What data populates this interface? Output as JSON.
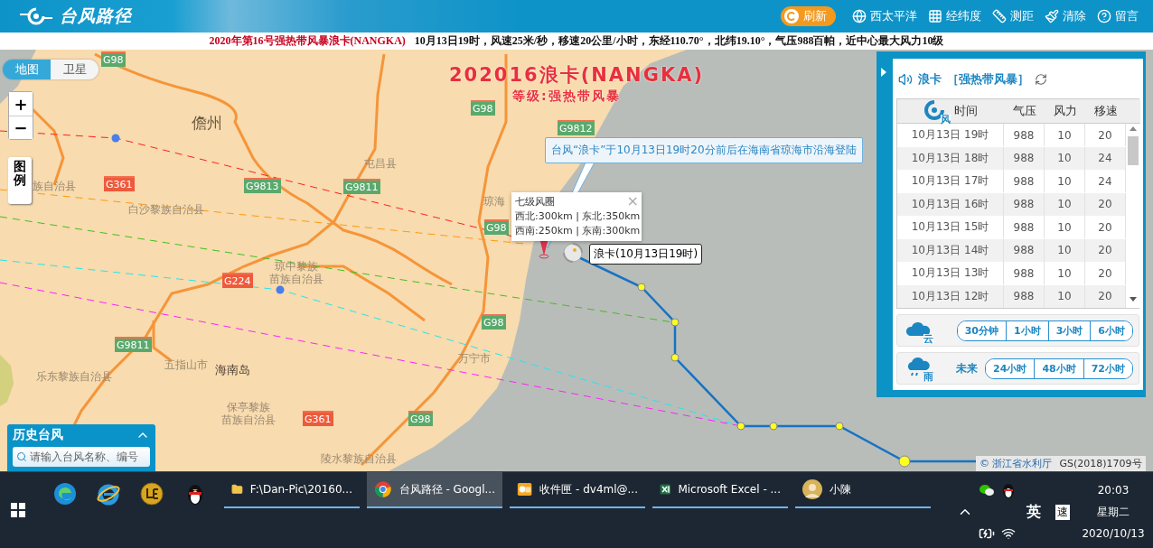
{
  "header": {
    "logo": "台风路径",
    "refresh": "刷新",
    "tools": [
      {
        "label": "西太平洋",
        "kind": "globe"
      },
      {
        "label": "经纬度",
        "kind": "grid"
      },
      {
        "label": "测距",
        "kind": "ruler"
      },
      {
        "label": "清除",
        "kind": "brush"
      },
      {
        "label": "留言",
        "kind": "help"
      }
    ]
  },
  "bulletin": {
    "headline": "2020年第16号强热带风暴浪卡(NANGKA)",
    "details": "10月13日19时，风速25米/秒，移速20公里/小时，东经110.70°，北纬19.10°，气压988百帕，近中心最大风力10级"
  },
  "map": {
    "view_tabs": [
      {
        "label": "地图",
        "selected": true
      },
      {
        "label": "卫星",
        "selected": false
      }
    ],
    "zoom_in": "+",
    "zoom_out": "−",
    "legend": "图例",
    "storm_title": "202016浪卡(NANGKA)",
    "storm_grade": "等级:强热带风暴",
    "landfall_note": "台风“浪卡”于10月13日19时20分前后在海南省琼海市沿海登陆",
    "wind_circle": {
      "title": "七级风圈",
      "close": "×",
      "lines": [
        "西北:300km | 东北:350km",
        "西南:250km | 东南:300km"
      ]
    },
    "position_label": "浪卡(10月13日19时)",
    "places": [
      {
        "lines": [
          "儋州"
        ],
        "kind": "city"
      },
      {
        "lines": [
          "屯昌县"
        ],
        "kind": "county"
      },
      {
        "lines": [
          "族自治县"
        ],
        "kind": "county"
      },
      {
        "lines": [
          "白沙黎族自治县"
        ],
        "kind": "county"
      },
      {
        "lines": [
          "琼中黎族",
          "苗族自治县"
        ],
        "kind": "county"
      },
      {
        "lines": [
          "五指山市"
        ],
        "kind": "county"
      },
      {
        "lines": [
          "海南岛"
        ],
        "kind": "region"
      },
      {
        "lines": [
          "乐东黎族自治县"
        ],
        "kind": "county"
      },
      {
        "lines": [
          "保亭黎族",
          "苗族自治县"
        ],
        "kind": "county"
      },
      {
        "lines": [
          "陵水黎族自治县"
        ],
        "kind": "county"
      },
      {
        "lines": [
          "万宁市"
        ],
        "kind": "county"
      },
      {
        "lines": [
          "琼海"
        ],
        "kind": "county"
      }
    ],
    "roads": [
      {
        "code": "G98",
        "color": "#5aa96c"
      },
      {
        "code": "G361",
        "color": "#ee5a3c"
      },
      {
        "code": "G9813",
        "color": "#5aa96c"
      },
      {
        "code": "G9811",
        "color": "#5aa96c"
      },
      {
        "code": "G224",
        "color": "#ee5a3c"
      },
      {
        "code": "G9811",
        "color": "#5aa96c"
      },
      {
        "code": "G361",
        "color": "#ee5a3c"
      },
      {
        "code": "G98",
        "color": "#5aa96c"
      },
      {
        "code": "G98",
        "color": "#5aa96c"
      },
      {
        "code": "G9812",
        "color": "#5aa96c"
      },
      {
        "code": "G98",
        "color": "#5aa96c"
      },
      {
        "code": "G98",
        "color": "#5aa96c"
      }
    ],
    "history": {
      "title": "历史台风",
      "placeholder": "请输入台风名称、编号"
    },
    "attribution": "© 浙江省水利厅",
    "license": "GS(2018)1709号"
  },
  "panel": {
    "name": "浪卡",
    "grade": "［强热带风暴］",
    "wind_badge": "风",
    "columns": [
      "时间",
      "气压",
      "风力",
      "移速"
    ],
    "rows": [
      [
        "10月13日 19时",
        "988",
        "10",
        "20"
      ],
      [
        "10月13日 18时",
        "988",
        "10",
        "24"
      ],
      [
        "10月13日 17时",
        "988",
        "10",
        "24"
      ],
      [
        "10月13日 16时",
        "988",
        "10",
        "20"
      ],
      [
        "10月13日 15时",
        "988",
        "10",
        "20"
      ],
      [
        "10月13日 14时",
        "988",
        "10",
        "20"
      ],
      [
        "10月13日 13时",
        "988",
        "10",
        "20"
      ],
      [
        "10月13日 12时",
        "988",
        "10",
        "20"
      ]
    ],
    "cloud": {
      "badge": "云",
      "buttons": [
        "30分钟",
        "1小时",
        "3小时",
        "6小时"
      ]
    },
    "rain": {
      "badge": "雨",
      "label": "未来",
      "buttons": [
        "24小时",
        "48小时",
        "72小时"
      ]
    }
  },
  "taskbar": {
    "tasks": [
      {
        "label": "F:\\Dan-Pic\\20160...",
        "kind": "folder",
        "selected": false
      },
      {
        "label": "台风路径 - Googl...",
        "kind": "chrome",
        "selected": true
      },
      {
        "label": "收件匣 - dv4ml@...",
        "kind": "mail",
        "selected": false
      },
      {
        "label": "Microsoft Excel - ...",
        "kind": "excel",
        "selected": false
      },
      {
        "label": "小陳",
        "kind": "avatar",
        "selected": false
      }
    ],
    "tray": {
      "ime": "英",
      "speed": "速",
      "time": "20:03",
      "weekday": "星期二",
      "date": "2020/10/13"
    }
  }
}
